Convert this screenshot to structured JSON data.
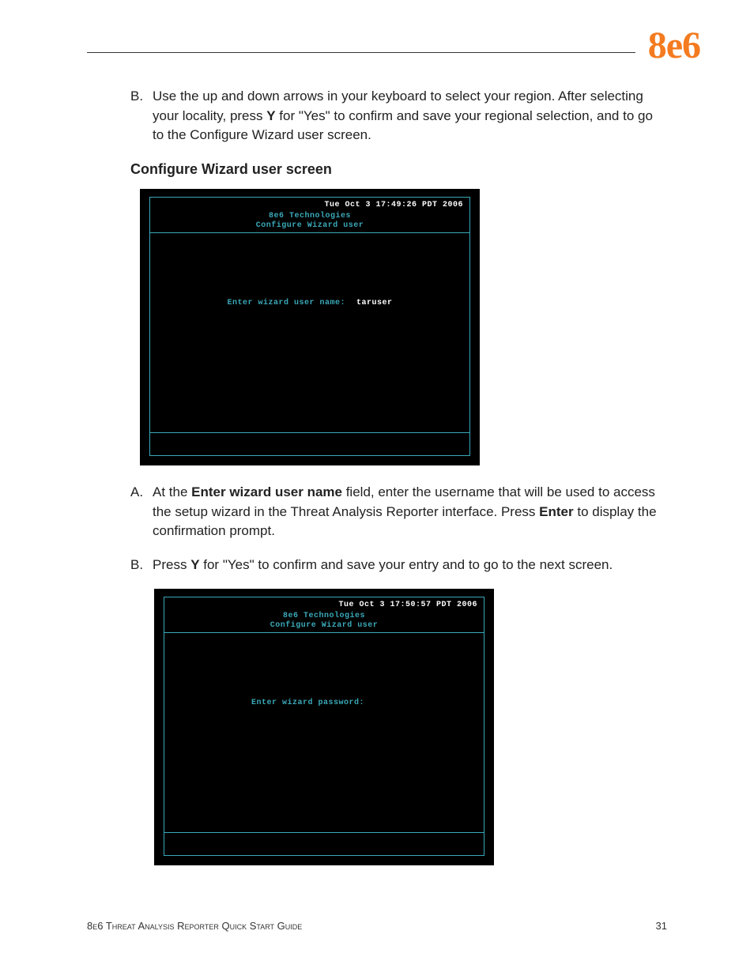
{
  "logo": "8e6",
  "intro_item": {
    "marker": "B.",
    "text_parts": [
      "Use the up and down arrows in your keyboard to select your region. After selecting your locality, press ",
      "Y",
      " for \"Yes\" to confirm and save your regional selection, and to go to the Configure Wizard user screen."
    ]
  },
  "section_heading": "Configure Wizard user screen",
  "terminal1": {
    "timestamp": "Tue Oct  3 17:49:26 PDT 2006",
    "company": "8e6 Technologies",
    "title": "Configure Wizard user",
    "prompt": "Enter wizard user name:",
    "value": "taruser"
  },
  "item_a": {
    "marker": "A.",
    "text_parts": [
      "At the ",
      "Enter wizard user name",
      " field, enter the username that will be used to access the setup wizard in the Threat Analysis Reporter interface. Press ",
      "Enter",
      " to display the confirmation prompt."
    ]
  },
  "item_b": {
    "marker": "B.",
    "text_parts": [
      "Press ",
      "Y",
      " for \"Yes\" to confirm and save your entry and to go to the next screen."
    ]
  },
  "terminal2": {
    "timestamp": "Tue Oct  3 17:50:57 PDT 2006",
    "company": "8e6 Technologies",
    "title": "Configure Wizard user",
    "prompt": "Enter wizard password:"
  },
  "footer_left": "8e6 Threat Analysis Reporter Quick Start Guide",
  "footer_right": "31"
}
